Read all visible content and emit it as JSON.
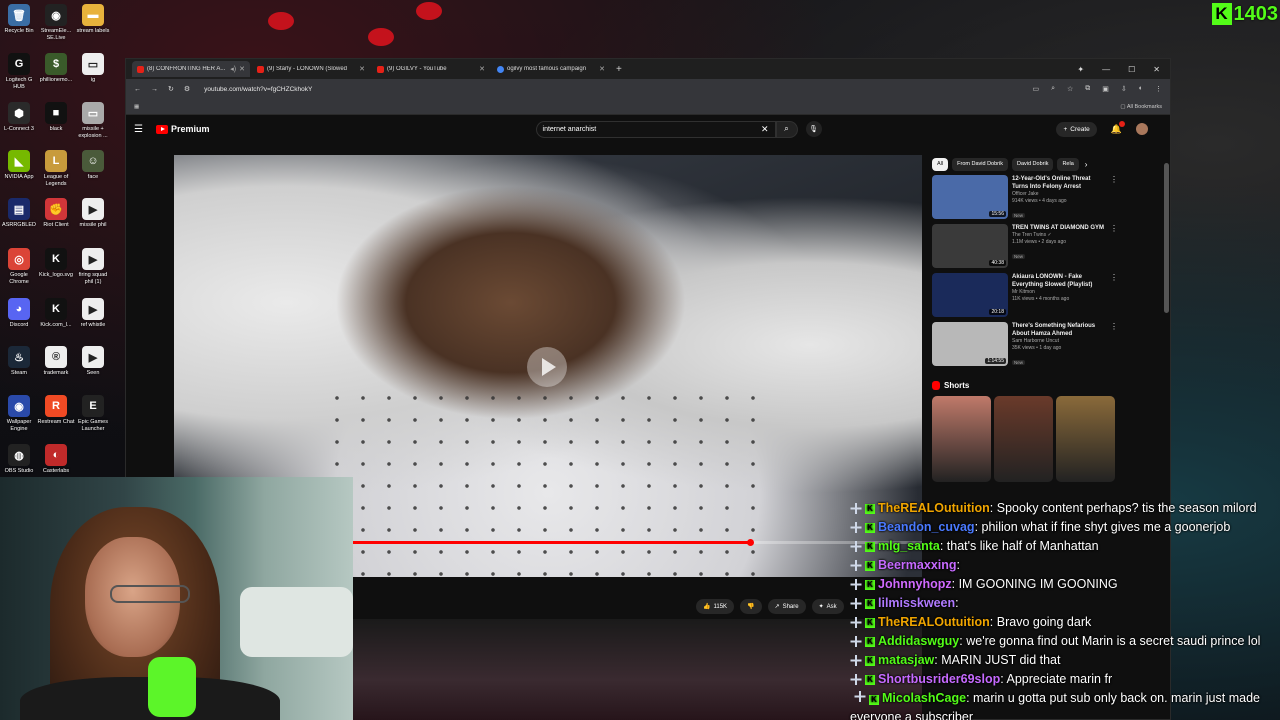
{
  "desktop": {
    "icons": [
      {
        "label": "Recycle Bin",
        "color": "#3a6ea5",
        "glyph": "🗑"
      },
      {
        "label": "StreamEle... SE.Live",
        "color": "#222",
        "glyph": "◉"
      },
      {
        "label": "stream labels",
        "color": "#e8b23c",
        "glyph": "▬"
      },
      {
        "label": "Logitech G HUB",
        "color": "#111",
        "glyph": "G"
      },
      {
        "label": "phillionemo...",
        "color": "#3a5a2a",
        "glyph": "$"
      },
      {
        "label": "ig",
        "color": "#eee",
        "glyph": "▭"
      },
      {
        "label": "L-Connect 3",
        "color": "#2a2a2a",
        "glyph": "⬢"
      },
      {
        "label": "black",
        "color": "#111",
        "glyph": "■"
      },
      {
        "label": "missile + explosion ...",
        "color": "#aaa",
        "glyph": "▭"
      },
      {
        "label": "NVIDIA App",
        "color": "#76b900",
        "glyph": "◣"
      },
      {
        "label": "League of Legends",
        "color": "#c89b3c",
        "glyph": "L"
      },
      {
        "label": "face",
        "color": "#4a5a3a",
        "glyph": "☺"
      },
      {
        "label": "ASRRGBLED",
        "color": "#1a2a6a",
        "glyph": "▤"
      },
      {
        "label": "Riot Client",
        "color": "#d13639",
        "glyph": "✊"
      },
      {
        "label": "missile phil",
        "color": "#eee",
        "glyph": "▶"
      },
      {
        "label": "Google Chrome",
        "color": "#db4437",
        "glyph": "◎"
      },
      {
        "label": "Kick_logo.svg",
        "color": "#111",
        "glyph": "K"
      },
      {
        "label": "firing squad phil (1)",
        "color": "#eee",
        "glyph": "▶"
      },
      {
        "label": "Discord",
        "color": "#5865f2",
        "glyph": "◕"
      },
      {
        "label": "Kick.com_l...",
        "color": "#111",
        "glyph": "K"
      },
      {
        "label": "ref whistle",
        "color": "#eee",
        "glyph": "▶"
      },
      {
        "label": "Steam",
        "color": "#1b2838",
        "glyph": "♨"
      },
      {
        "label": "trademark",
        "color": "#eee",
        "glyph": "®"
      },
      {
        "label": "Seen",
        "color": "#eee",
        "glyph": "▶"
      },
      {
        "label": "Wallpaper Engine",
        "color": "#2a4aaa",
        "glyph": "◉"
      },
      {
        "label": "Restream Chat",
        "color": "#f04a24",
        "glyph": "R"
      },
      {
        "label": "Epic Games Launcher",
        "color": "#222",
        "glyph": "E"
      },
      {
        "label": "OBS Studio",
        "color": "#222",
        "glyph": "◍"
      },
      {
        "label": "Casterlabs",
        "color": "#c02a2a",
        "glyph": "◐"
      }
    ],
    "kick_badge": {
      "letter": "K",
      "count": "1403"
    }
  },
  "browser": {
    "tabs": [
      {
        "title": "(8) CONFRONTING HER A...",
        "active": true
      },
      {
        "title": "(9) Starly - LONOWN (Slowed",
        "active": false
      },
      {
        "title": "(9) OGILVY - YouTube",
        "active": false
      },
      {
        "title": "ogilvy most famous campaign",
        "active": false
      }
    ],
    "new_tab": "+",
    "window_controls": {
      "minimize": "—",
      "maximize": "☐",
      "close": "✕"
    },
    "url": "youtube.com/watch?v=fgCHZCkhokY",
    "all_bookmarks": "All Bookmarks"
  },
  "youtube": {
    "logo_text": "Premium",
    "search_value": "internet anarchist",
    "create_label": "Create",
    "notif_count": "9+",
    "video": {
      "progress_fraction": 0.77
    },
    "actions": [
      {
        "icon": "👍",
        "label": "115K",
        "name": "like-button"
      },
      {
        "icon": "👎",
        "label": "",
        "name": "dislike-button"
      },
      {
        "icon": "↗",
        "label": "Share",
        "name": "share-button"
      },
      {
        "icon": "✦",
        "label": "Ask",
        "name": "ask-button"
      }
    ],
    "chips": [
      "All",
      "From David Dobrik",
      "David Dobrik",
      "Rela"
    ],
    "recommendations": [
      {
        "title": "12-Year-Old's Online Threat Turns Into Felony Arrest",
        "channel": "Officer Jake",
        "meta": "914K views • 4 days ago",
        "badge": "New",
        "duration": "15:56",
        "thumb": "#4a6aa8"
      },
      {
        "title": "TREN TWINS AT DIAMOND GYM",
        "channel": "The Tren Twins ✓",
        "meta": "1.1M views • 2 days ago",
        "badge": "New",
        "duration": "40:38",
        "thumb": "#3a3a3a"
      },
      {
        "title": "Akiaura LONOWN - Fake Everything Slowed (Playlist)",
        "channel": "Mr Kitmon",
        "meta": "11K views • 4 months ago",
        "badge": "",
        "duration": "20:18",
        "thumb": "#1a2a5a"
      },
      {
        "title": "There's Something Nefarious About Hamza Ahmed",
        "channel": "Sam Harborne Uncut",
        "meta": "35K views • 1 day ago",
        "badge": "New",
        "duration": "1:14:55",
        "thumb": "#b8b8b8"
      }
    ],
    "shorts_label": "Shorts",
    "shorts": [
      "#c07a6a",
      "#6a3a2a",
      "#8a6a3a"
    ]
  },
  "chat": [
    {
      "user": "TheREALOutuition",
      "color": "#f0a500",
      "text": "Spooky content perhaps? tis the season milord"
    },
    {
      "user": "Beandon_cuvag",
      "color": "#4a7aff",
      "text": "philion what if fine shyt gives me a goonerjob"
    },
    {
      "user": "mlg_santa",
      "color": "#53fc18",
      "text": "that's like half of Manhattan"
    },
    {
      "user": "Beermaxxing",
      "color": "#c66aff",
      "text": ""
    },
    {
      "user": "Johnnyhopz",
      "color": "#d06aff",
      "text": "IM GOONING IM GOONING"
    },
    {
      "user": "lilmisskween",
      "color": "#b07aff",
      "text": ""
    },
    {
      "user": "TheREALOutuition",
      "color": "#f0a500",
      "text": "Bravo going dark"
    },
    {
      "user": "Addidaswguy",
      "color": "#53fc18",
      "text": "we're gonna find out Marin is a secret saudi prince lol"
    },
    {
      "user": "matasjaw",
      "color": "#53fc18",
      "text": "MARIN JUST did that"
    },
    {
      "user": "Shortbusrider69slop",
      "color": "#c66aff",
      "text": "Appreciate marin fr"
    },
    {
      "user": "MicolashCage",
      "color": "#53fc18",
      "text": "marin u gotta put sub only back on. marin just made everyone a subscriber"
    }
  ]
}
